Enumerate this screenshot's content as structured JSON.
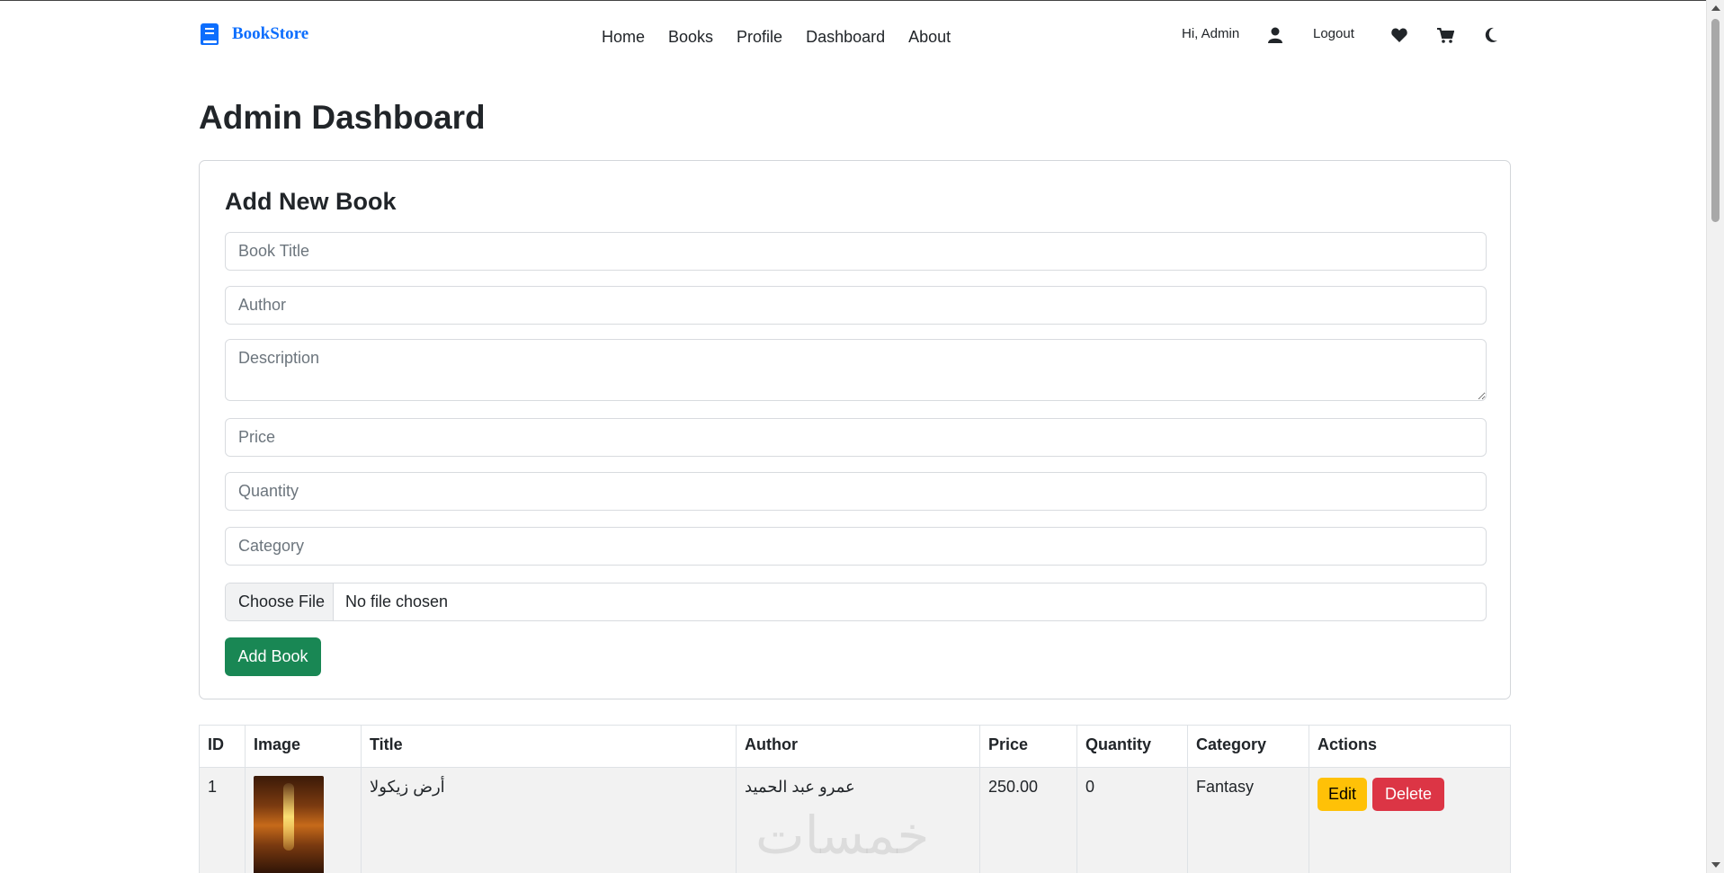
{
  "brand": {
    "name": "BookStore",
    "icon": "book-icon",
    "color": "#0d6efd"
  },
  "nav": {
    "links": [
      "Home",
      "Books",
      "Profile",
      "Dashboard",
      "About"
    ],
    "greeting": "Hi, Admin",
    "logout": "Logout",
    "icons": [
      "user-icon",
      "heart-icon",
      "cart-icon",
      "moon-icon"
    ]
  },
  "page": {
    "title": "Admin Dashboard"
  },
  "form": {
    "title": "Add New Book",
    "placeholders": {
      "title": "Book Title",
      "author": "Author",
      "description": "Description",
      "price": "Price",
      "quantity": "Quantity",
      "category": "Category"
    },
    "file_button": "Choose File",
    "file_status": "No file chosen",
    "submit": "Add Book",
    "submit_color": "#198754"
  },
  "table": {
    "headers": [
      "ID",
      "Image",
      "Title",
      "Author",
      "Price",
      "Quantity",
      "Category",
      "Actions"
    ],
    "rows": [
      {
        "id": "1",
        "title": "أرض زيكولا",
        "author": "عمرو عبد الحميد",
        "price": "250.00",
        "quantity": "0",
        "category": "Fantasy",
        "edit": "Edit",
        "delete": "Delete"
      }
    ]
  },
  "watermark": "خمسات",
  "colors": {
    "edit": "#ffc107",
    "delete": "#dc3545"
  }
}
